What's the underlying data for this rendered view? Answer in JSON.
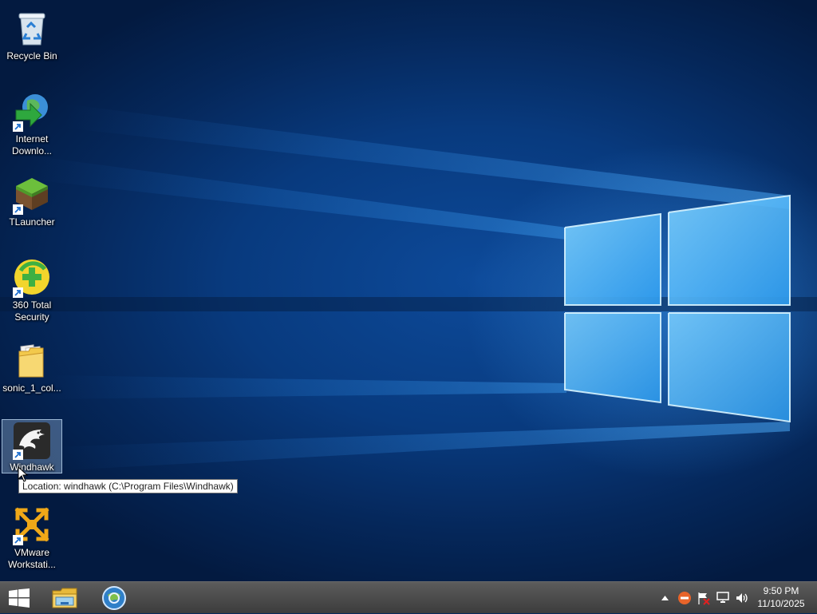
{
  "desktop": {
    "icons": [
      {
        "label": "Recycle Bin",
        "icon": "recycle-bin-icon",
        "selected": false
      },
      {
        "label": "Internet\nDownlo...",
        "icon": "internet-download-manager-icon",
        "selected": false
      },
      {
        "label": "TLauncher",
        "icon": "tlauncher-icon",
        "selected": false
      },
      {
        "label": "360 Total\nSecurity",
        "icon": "360-total-security-icon",
        "selected": false
      },
      {
        "label": "sonic_1_col...",
        "icon": "folder-icon",
        "selected": false
      },
      {
        "label": "Windhawk",
        "icon": "windhawk-icon",
        "selected": true
      },
      {
        "label": "VMware\nWorkstati...",
        "icon": "vmware-workstation-icon",
        "selected": false
      }
    ],
    "tooltip": "Location: windhawk (C:\\Program Files\\Windhawk)"
  },
  "taskbar": {
    "pinned": [
      {
        "name": "start-button",
        "icon": "windows-logo-icon"
      },
      {
        "name": "file-explorer-button",
        "icon": "file-explorer-icon"
      },
      {
        "name": "internet-download-manager-button",
        "icon": "internet-download-manager-icon"
      }
    ],
    "tray": {
      "icons": [
        "show-hidden-icons-chevron",
        "antivirus-tray-icon",
        "action-center-flag-icon",
        "network-icon",
        "volume-icon"
      ]
    },
    "clock": {
      "time": "9:50 PM",
      "date": "11/10/2025"
    }
  },
  "colors": {
    "taskbar_bg": "#4a4a4a",
    "desktop_bg": "#0a3d82",
    "selection": "#aac8eb"
  }
}
